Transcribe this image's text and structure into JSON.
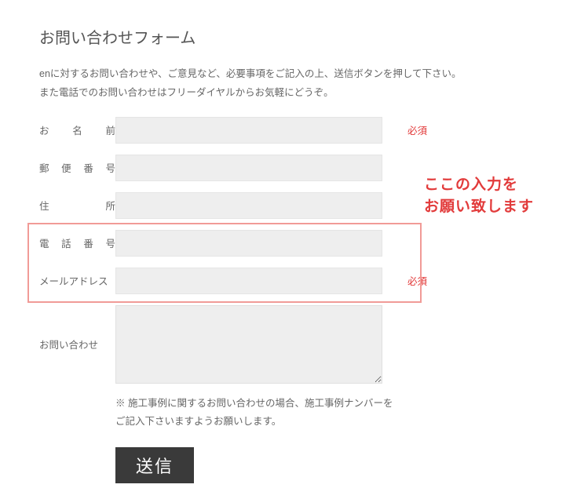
{
  "title": "お問い合わせフォーム",
  "intro_line1": "enに対するお問い合わせや、ご意見など、必要事項をご記入の上、送信ボタンを押して下さい。",
  "intro_line2": "また電話でのお問い合わせはフリーダイヤルからお気軽にどうぞ。",
  "fields": {
    "name": {
      "label": "お名前",
      "required": "必須"
    },
    "postal": {
      "label": "郵便番号"
    },
    "address": {
      "label": "住所"
    },
    "phone": {
      "label": "電話番号"
    },
    "email": {
      "label": "メールアドレス",
      "required": "必須"
    },
    "inquiry": {
      "label": "お問い合わせ"
    }
  },
  "note_line1": "※ 施工事例に関するお問い合わせの場合、施工事例ナンバーを",
  "note_line2": "ご記入下さいますようお願いします。",
  "submit": "送信",
  "annotation_line1": "ここの入力を",
  "annotation_line2": "お願い致します"
}
